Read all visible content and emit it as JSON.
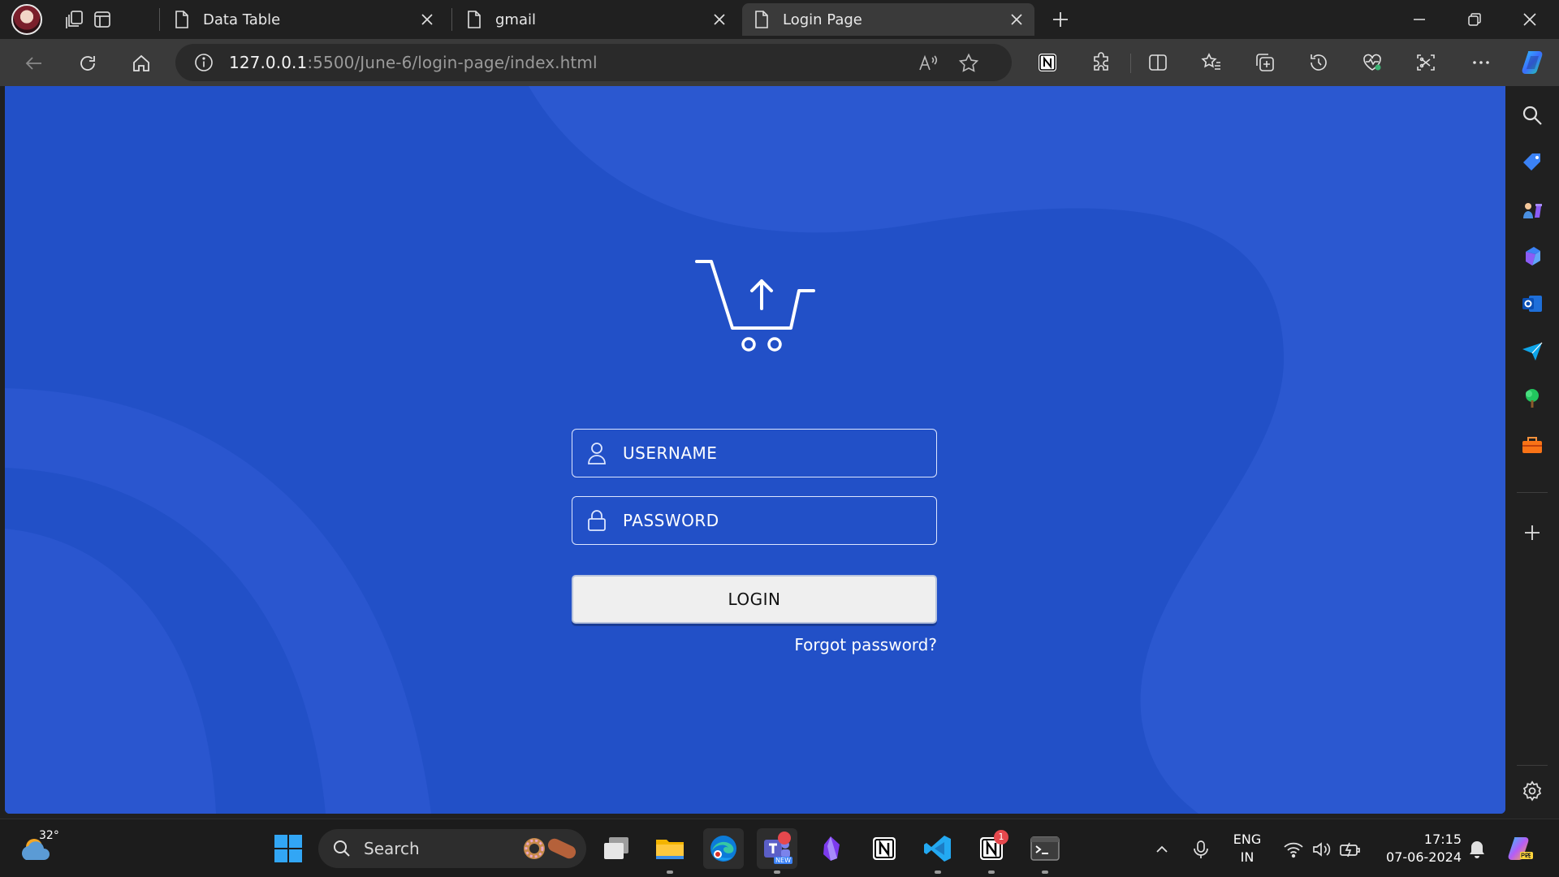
{
  "browser": {
    "tabs": [
      {
        "title": "Data Table"
      },
      {
        "title": "gmail"
      },
      {
        "title": "Login Page"
      }
    ],
    "url": {
      "host": "127.0.0.1",
      "rest": ":5500/June-6/login-page/index.html"
    }
  },
  "login": {
    "username_placeholder": "USERNAME",
    "password_placeholder": "PASSWORD",
    "login_label": "LOGIN",
    "forgot_label": "Forgot password?"
  },
  "colors": {
    "page_background": "#2250c7",
    "field_border": "#dde6ff",
    "login_button": "#efefef"
  },
  "taskbar": {
    "temperature": "32°",
    "search_label": "Search",
    "language_line1": "ENG",
    "language_line2": "IN",
    "time": "17:15",
    "date": "07-06-2024",
    "notion_badge": "1",
    "teams_badge_text": "NEW"
  }
}
